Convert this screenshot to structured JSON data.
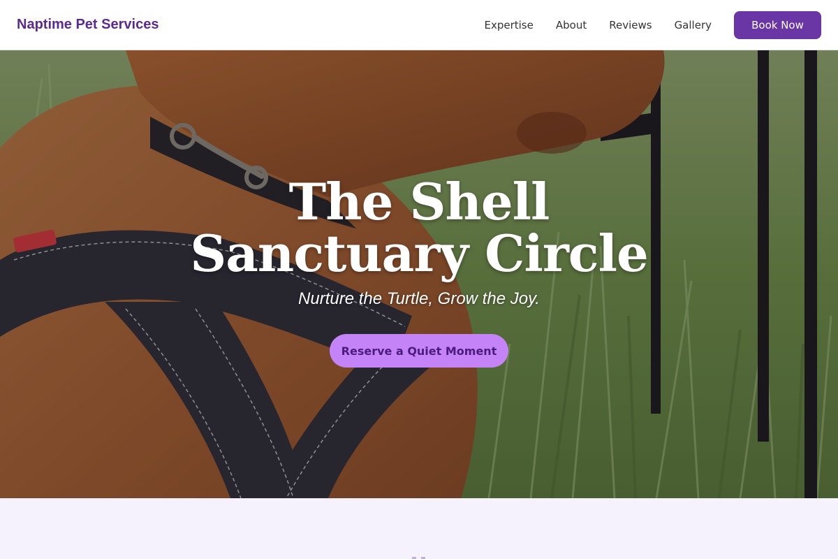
{
  "nav": {
    "brand": "Naptime Pet Services",
    "links": [
      {
        "label": "Expertise"
      },
      {
        "label": "About"
      },
      {
        "label": "Reviews"
      },
      {
        "label": "Gallery"
      }
    ],
    "cta": "Book Now"
  },
  "hero": {
    "title": "The Shell Sanctuary Circle",
    "tagline": "Nurture the Turtle, Grow the Joy.",
    "cta": "Reserve a Quiet Moment",
    "image_subject": "dog-with-collar-and-harness-photo"
  },
  "colors": {
    "brand": "#5b2a91",
    "nav_button": "#6a35a4",
    "hero_button": "#c583f8",
    "hero_button_text": "#4b1c7d",
    "section_bg": "#f6f2fd"
  }
}
